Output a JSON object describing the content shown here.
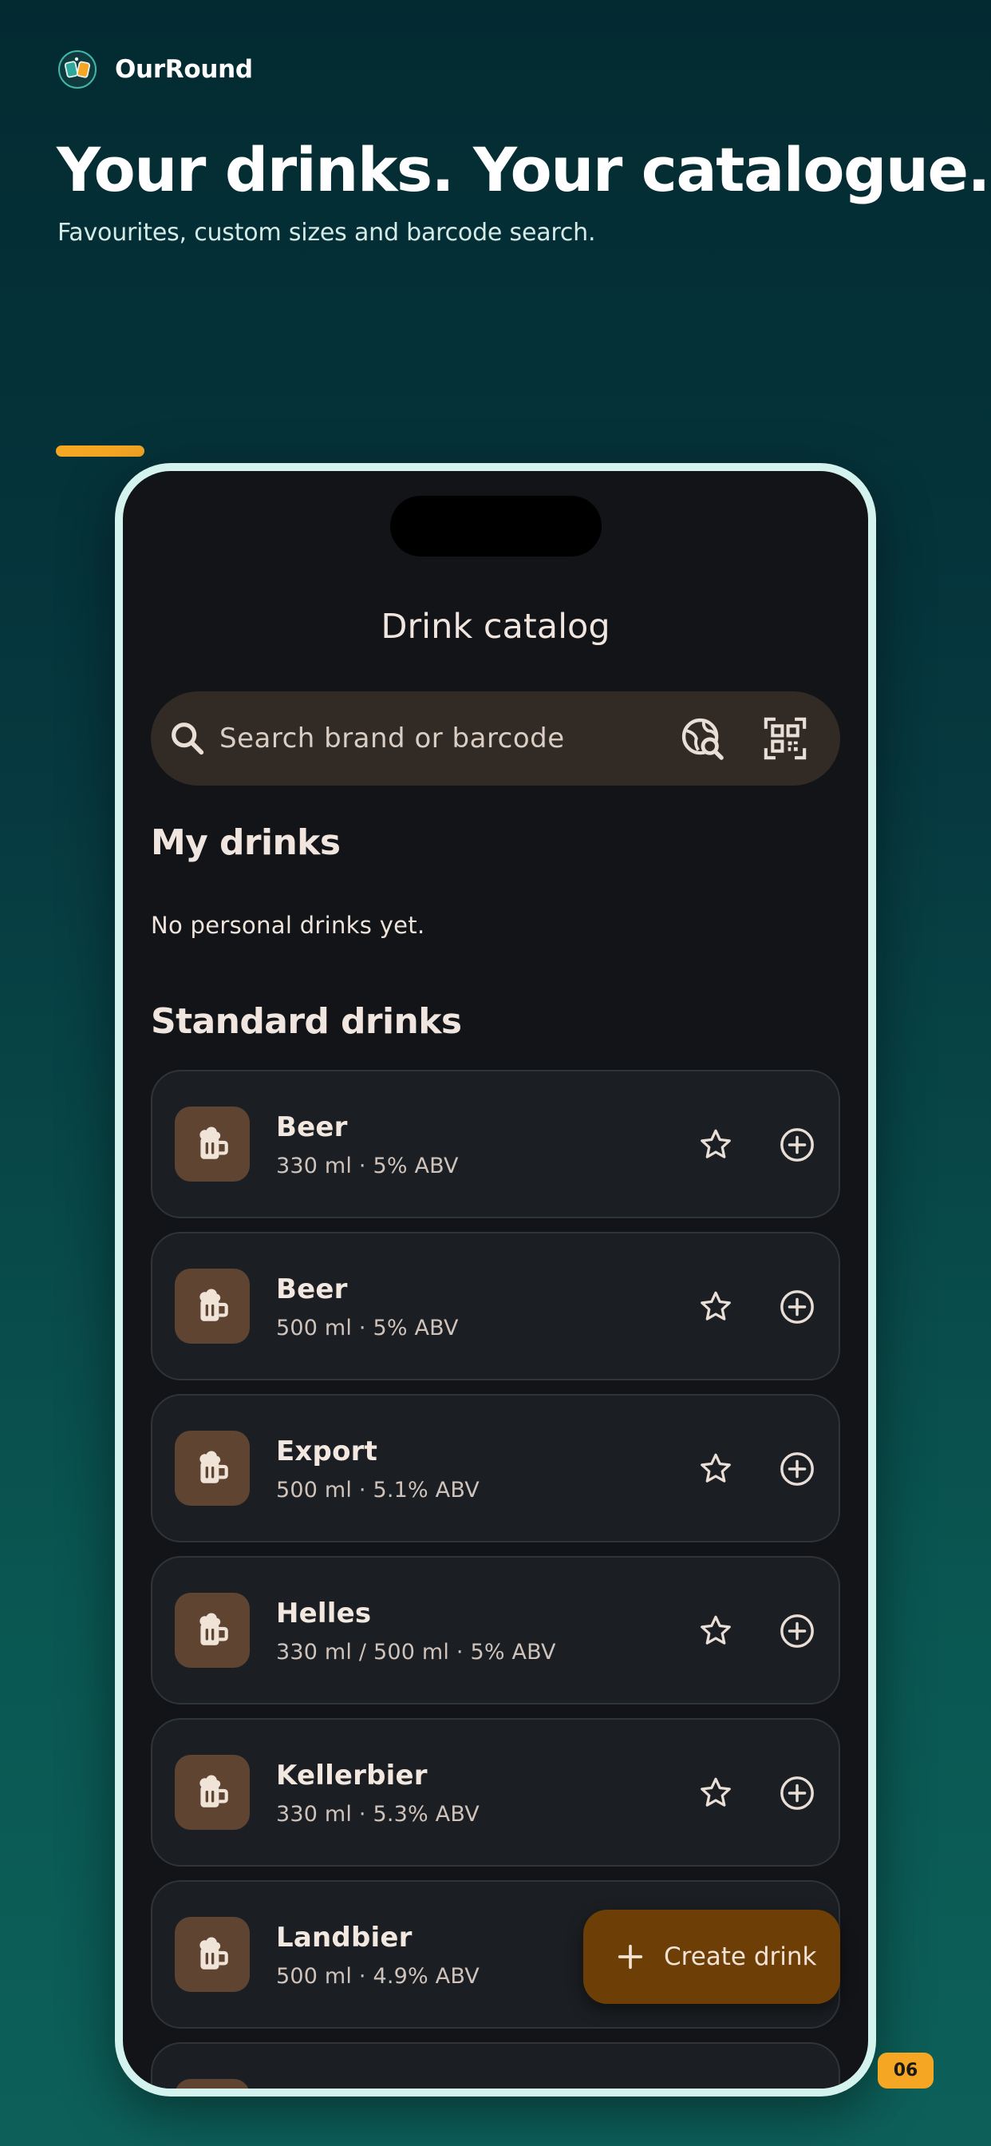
{
  "brand": {
    "name": "OurRound",
    "logo_icon": "drinks-cheers-icon"
  },
  "hero": {
    "title": "Your drinks. Your catalogue.",
    "subtitle": "Favourites, custom sizes and barcode search."
  },
  "app": {
    "title": "Drink catalog",
    "search": {
      "placeholder": "Search brand or barcode",
      "icon": "search-icon",
      "online_search_icon": "globe-search-icon",
      "scan_icon": "qr-code-scan-icon"
    },
    "my_drinks": {
      "title": "My drinks",
      "empty_text": "No personal drinks yet."
    },
    "standard_drinks": {
      "title": "Standard drinks",
      "items": [
        {
          "name": "Beer",
          "detail": "330 ml · 5% ABV"
        },
        {
          "name": "Beer",
          "detail": "500 ml · 5% ABV"
        },
        {
          "name": "Export",
          "detail": "500 ml · 5.1% ABV"
        },
        {
          "name": "Helles",
          "detail": "330 ml / 500 ml · 5% ABV"
        },
        {
          "name": "Kellerbier",
          "detail": "330 ml · 5.3% ABV"
        },
        {
          "name": "Landbier",
          "detail": "500 ml · 4.9% ABV"
        }
      ]
    },
    "fab": {
      "label": "Create drink",
      "icon": "plus-icon"
    }
  },
  "page_badge": "06",
  "colors": {
    "accent": "#f5a623",
    "surface": "#121417",
    "card": "#1b1e22",
    "drink_icon_bg": "#5f4432",
    "fab": "#6d3f07"
  }
}
